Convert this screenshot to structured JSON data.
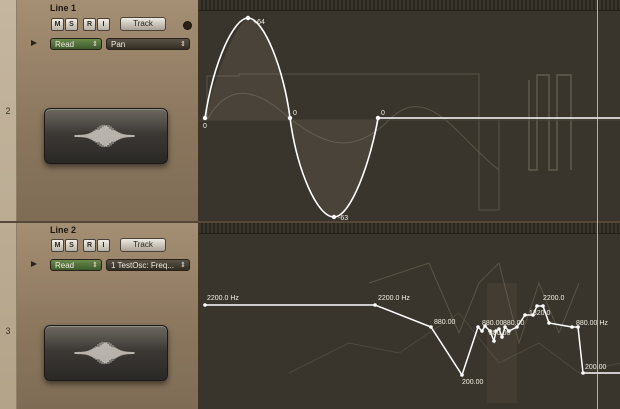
{
  "tracks": [
    {
      "number": "2",
      "name": "Line 1",
      "buttons": {
        "mute": "M",
        "solo": "S",
        "record": "R",
        "input": "I"
      },
      "track_button": "Track",
      "automation_mode": "Read",
      "parameter": "Pan",
      "points": [
        {
          "label": "0"
        },
        {
          "label": "+64"
        },
        {
          "label": "0"
        },
        {
          "label": "-63"
        },
        {
          "label": "0"
        }
      ]
    },
    {
      "number": "3",
      "name": "Line 2",
      "buttons": {
        "mute": "M",
        "solo": "S",
        "record": "R",
        "input": "I"
      },
      "track_button": "Track",
      "automation_mode": "Read",
      "parameter": "1 TestOsc: Freq...",
      "points": [
        {
          "label": "2200.0 Hz"
        },
        {
          "label": "2200.0 Hz"
        },
        {
          "label": "880.00"
        },
        {
          "label": "200.00"
        },
        {
          "label": "880.00"
        },
        {
          "label": "880.00"
        },
        {
          "label": "880.00"
        },
        {
          "label": "2200.0"
        },
        {
          "label": "1320.0"
        },
        {
          "label": "880.00 Hz"
        },
        {
          "label": "200.00"
        }
      ]
    }
  ],
  "colors": {
    "lane_bg": "#3a352c",
    "curve": "#ffffff",
    "read_mode": "#4f6f3a"
  },
  "icons": [
    "play-icon",
    "dot-icon",
    "chevron-updown-icon",
    "waveform-icon"
  ]
}
